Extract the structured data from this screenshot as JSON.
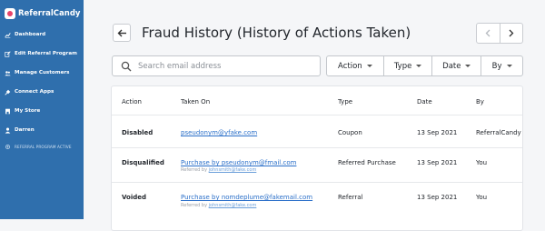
{
  "brand": {
    "name": "ReferralCandy"
  },
  "sidebar": {
    "items": [
      {
        "label": "Dashboard",
        "icon": "chart-line-icon"
      },
      {
        "label": "Edit Referral Program",
        "icon": "edit-icon"
      },
      {
        "label": "Manage Customers",
        "icon": "users-icon"
      },
      {
        "label": "Connect Apps",
        "icon": "plug-icon"
      },
      {
        "label": "My Store",
        "icon": "store-icon"
      },
      {
        "label": "Darren",
        "icon": "user-icon"
      }
    ],
    "program_status": "REFERRAL PROGRAM ACTIVE"
  },
  "header": {
    "title": "Fraud History (History of Actions Taken)"
  },
  "search": {
    "placeholder": "Search email address",
    "value": ""
  },
  "filters": [
    "Action",
    "Type",
    "Date",
    "By"
  ],
  "table": {
    "columns": [
      "Action",
      "Taken On",
      "Type",
      "Date",
      "By"
    ],
    "rows": [
      {
        "action": "Disabled",
        "taken_on": "pseudonym@yfake.com",
        "referred_by_prefix": "",
        "referred_by": "",
        "type": "Coupon",
        "date": "13 Sep 2021",
        "by": "ReferralCandy"
      },
      {
        "action": "Disqualified",
        "taken_on": "Purchase by pseudonym@fmail.com",
        "referred_by_prefix": "Referred by",
        "referred_by": "johnsmith@fake.com",
        "type": "Referred Purchase",
        "date": "13 Sep 2021",
        "by": "You"
      },
      {
        "action": "Voided",
        "taken_on": "Purchase by nomdeplume@fakemail.com",
        "referred_by_prefix": "Referred by",
        "referred_by": "johnsmith@fake.com",
        "type": "Referral",
        "date": "13 Sep 2021",
        "by": "You"
      }
    ]
  },
  "colors": {
    "sidebar": "#2f6fad",
    "link": "#2a6fc9",
    "background": "#f5f6f8"
  }
}
